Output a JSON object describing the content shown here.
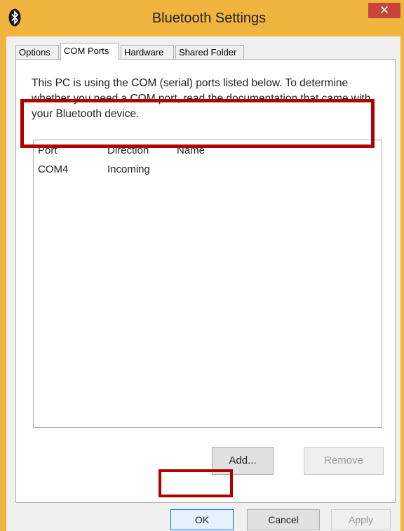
{
  "window": {
    "title": "Bluetooth Settings",
    "title_icon": "bluetooth-icon",
    "close_label": "✕",
    "accent_color": "#f0b53f",
    "close_color": "#c7443a"
  },
  "tabs": [
    {
      "label": "Options",
      "active": false
    },
    {
      "label": "COM Ports",
      "active": true
    },
    {
      "label": "Hardware",
      "active": false
    },
    {
      "label": "Shared Folder",
      "active": false
    }
  ],
  "com_ports": {
    "description": "This PC is using the COM (serial) ports listed below. To determine whether you need a COM port, read the documentation that came with your Bluetooth device.",
    "columns": [
      "Port",
      "Direction",
      "Name"
    ],
    "rows": [
      {
        "port": "COM4",
        "direction": "Incoming",
        "name": ""
      }
    ],
    "add_label": "Add...",
    "remove_label": "Remove"
  },
  "footer": {
    "ok_label": "OK",
    "cancel_label": "Cancel",
    "apply_label": "Apply"
  },
  "highlight_color": "#b00000"
}
